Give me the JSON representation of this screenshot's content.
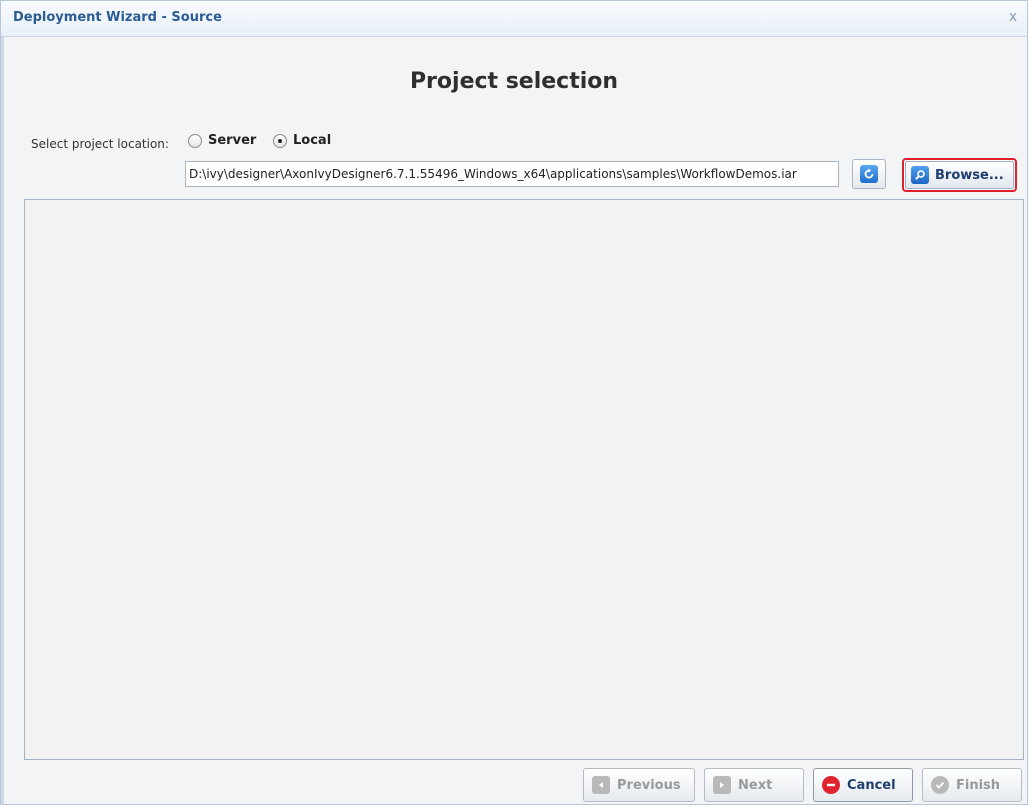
{
  "window": {
    "title": "Deployment Wizard - Source",
    "close_glyph": "x"
  },
  "page": {
    "title": "Project selection"
  },
  "location": {
    "label": "Select project location:",
    "options": [
      {
        "label": "Server",
        "selected": false
      },
      {
        "label": "Local",
        "selected": true
      }
    ],
    "path_value": "D:\\ivy\\designer\\AxonIvyDesigner6.7.1.55496_Windows_x64\\applications\\samples\\WorkflowDemos.iar"
  },
  "toolbar": {
    "refresh_icon": "refresh-icon",
    "browse_icon": "magnifier-icon",
    "browse_label": "Browse..."
  },
  "footer": {
    "previous_label": "Previous",
    "next_label": "Next",
    "cancel_label": "Cancel",
    "finish_label": "Finish"
  },
  "colors": {
    "title_blue": "#2a5b94",
    "highlight_red": "#e0202a",
    "cancel_red": "#e0242e",
    "icon_blue": "#1f6fcc"
  }
}
